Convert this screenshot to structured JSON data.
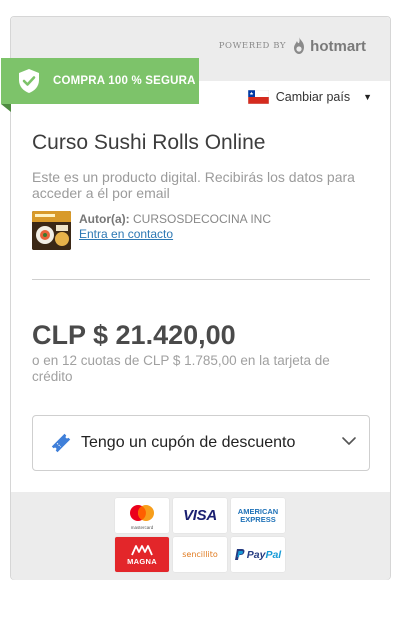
{
  "header": {
    "powered_by": "POWERED BY",
    "brand": "hotmart",
    "secure_badge": "COMPRA 100 % SEGURA",
    "country_label": "Cambiar país"
  },
  "product": {
    "title": "Curso Sushi Rolls Online",
    "description": "Este es un producto digital. Recibirás los datos para acceder a él por email",
    "author_label": "Autor(a):",
    "author_name": "CURSOSDECOCINA INC",
    "contact_link": "Entra en contacto"
  },
  "pricing": {
    "price": "CLP $ 21.420,00",
    "installments": "o en 12 cuotas de CLP $ 1.785,00 en la tarjeta de crédito"
  },
  "coupon": {
    "label": "Tengo un cupón de descuento"
  },
  "payments": {
    "methods": [
      {
        "name": "mastercard",
        "label": "mastercard"
      },
      {
        "name": "visa",
        "label": "VISA"
      },
      {
        "name": "amex",
        "label_top": "AMERICAN",
        "label_bottom": "EXPRESS"
      },
      {
        "name": "magna",
        "label": "MAGNA"
      },
      {
        "name": "sencillito",
        "label": "sencillito"
      },
      {
        "name": "paypal",
        "label_a": "Pay",
        "label_b": "Pal"
      }
    ]
  },
  "colors": {
    "secure_green": "#7dc36a",
    "link_blue": "#2d78b4",
    "coupon_icon_blue": "#3f7fd9",
    "band_gray": "#ececec"
  },
  "icons": {
    "flag": "chile-flag-icon",
    "shield": "shield-check-icon",
    "coupon": "ticket-icon",
    "chevron": "chevron-down-icon"
  }
}
